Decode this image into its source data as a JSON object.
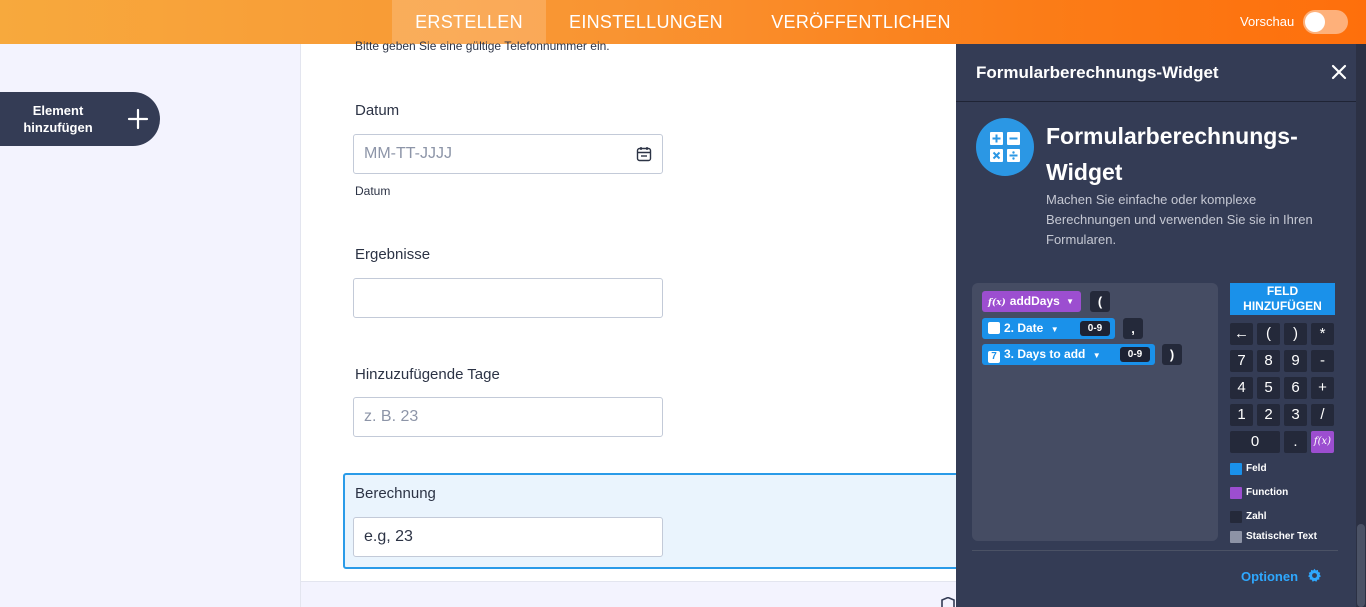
{
  "topbar": {
    "tabs": [
      {
        "label": "ERSTELLEN",
        "active": true
      },
      {
        "label": "EINSTELLUNGEN",
        "active": false
      },
      {
        "label": "VERÖFFENTLICHEN",
        "active": false
      }
    ],
    "preview_label": "Vorschau",
    "preview_on": false
  },
  "sidebar": {
    "add_element_label": "Element hinzufügen"
  },
  "form": {
    "top_hint": "Bitte geben Sie eine gültige Telefonnummer ein.",
    "fields": [
      {
        "label": "Datum",
        "placeholder": "MM-TT-JJJJ",
        "sublabel": "Datum"
      },
      {
        "label": "Ergebnisse",
        "placeholder": ""
      },
      {
        "label": "Hinzuzufügende Tage",
        "placeholder": "z. B. 23"
      },
      {
        "label": "Berechnung",
        "value": "e.g, 23"
      }
    ]
  },
  "panel": {
    "header_title": "Formularberechnungs-Widget",
    "widget_name": "Formularberechnungs-Widget",
    "widget_description": "Machen Sie einfache oder komplexe Berechnungen und verwenden Sie sie in Ihren Formularen.",
    "formula": {
      "function_name": "addDays",
      "fx_label": "f(x)",
      "open_paren": "(",
      "comma": ",",
      "close_paren": ")",
      "field1": "2. Date",
      "field2": "3. Days to add",
      "field2_number": "7",
      "type_tag": "0-9"
    },
    "add_field_label": "FELD HINZUFÜGEN",
    "keypad": [
      "←",
      "(",
      ")",
      "*",
      "7",
      "8",
      "9",
      "-",
      "4",
      "5",
      "6",
      "+",
      "1",
      "2",
      "3",
      "/",
      "0",
      ".",
      "f(x)"
    ],
    "legend": [
      {
        "label": "Feld",
        "color": "#1a91ea"
      },
      {
        "label": "Function",
        "color": "#9c4ed0"
      },
      {
        "label": "Zahl",
        "color": "#24293a"
      },
      {
        "label": "Statischer Text",
        "color": "#8d93a6"
      }
    ],
    "options_label": "Optionen"
  },
  "colors": {
    "accent_orange": "#fb7d18",
    "selection_blue": "#2a9be8",
    "panel_dark": "#343c55"
  }
}
